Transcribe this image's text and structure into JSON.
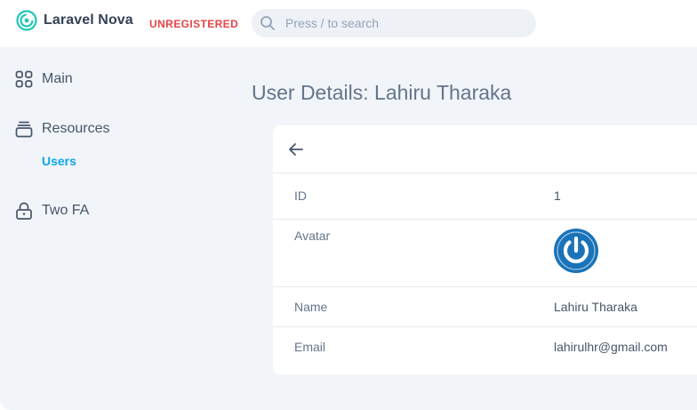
{
  "header": {
    "brand_name": "Laravel Nova",
    "license_status": "UNREGISTERED",
    "search_placeholder": "Press / to search",
    "logo_icon": "nova-logo-icon",
    "search_icon": "search-icon"
  },
  "sidebar": {
    "items": [
      {
        "label": "Main",
        "icon": "grid-icon"
      },
      {
        "label": "Resources",
        "icon": "archive-icon",
        "children": [
          {
            "label": "Users",
            "active": true
          }
        ]
      },
      {
        "label": "Two FA",
        "icon": "lock-icon"
      }
    ]
  },
  "page": {
    "title": "User Details: Lahiru Tharaka"
  },
  "detail": {
    "back_icon": "arrow-left-icon",
    "fields": [
      {
        "label": "ID",
        "value": "1"
      },
      {
        "label": "Avatar",
        "value": "",
        "icon": "avatar-power-icon"
      },
      {
        "label": "Name",
        "value": "Lahiru Tharaka"
      },
      {
        "label": "Email",
        "value": "lahirulhr@gmail.com"
      }
    ]
  },
  "colors": {
    "accent": "#0ea5e9",
    "unregistered": "#e74444",
    "background": "#f1f5f9",
    "avatar": "#1a73b8"
  }
}
